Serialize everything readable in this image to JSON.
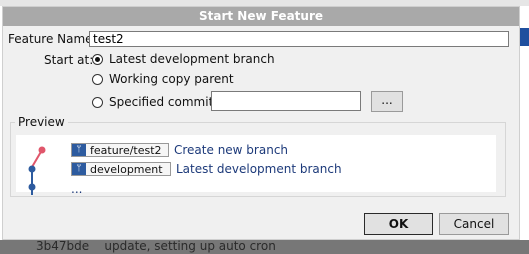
{
  "background": {
    "commit_line": "3b47bde    update, setting up auto cron"
  },
  "dialog": {
    "title": "Start New Feature",
    "feature_name_label": "Feature Name:",
    "feature_name_value": "test2",
    "start_at_label": "Start at:",
    "options": [
      {
        "label": "Latest development branch",
        "selected": true
      },
      {
        "label": "Working copy parent",
        "selected": false
      },
      {
        "label": "Specified commit:",
        "selected": false
      }
    ],
    "specified_commit_value": "",
    "browse_label": "...",
    "preview_label": "Preview",
    "preview": {
      "rows": [
        {
          "branch": "feature/test2",
          "description": "Create new branch"
        },
        {
          "branch": "development",
          "description": "Latest development branch"
        }
      ],
      "ellipsis": "..."
    },
    "ok_label": "OK",
    "cancel_label": "Cancel"
  },
  "colors": {
    "new_commit": "#e0566b",
    "existing_commit": "#2d5b9f",
    "branch_icon": "#2d5b9f",
    "title_bar": "#a9a9a9"
  },
  "icons": {
    "branch": "branch-icon"
  }
}
